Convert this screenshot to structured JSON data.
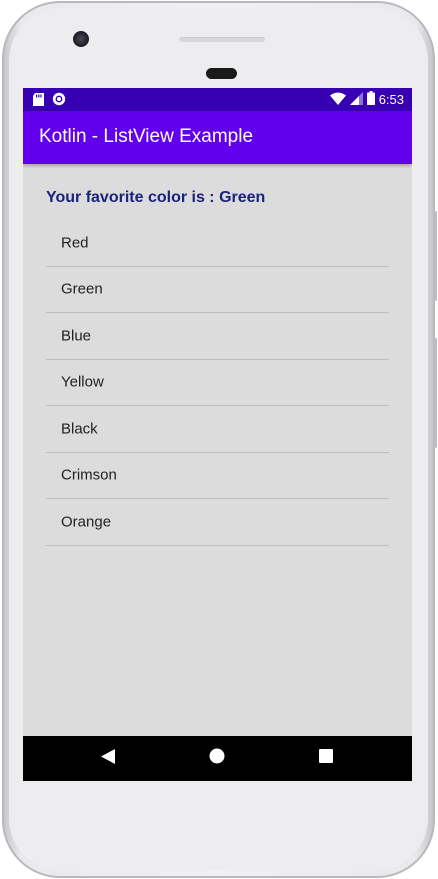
{
  "device": {
    "frame_color": "#f1f1f3",
    "camera_icon": "front-camera-icon",
    "speaker_icon": "earpiece-speaker-icon",
    "sensor_icon": "proximity-sensor-icon"
  },
  "status_bar": {
    "background": "#3700b3",
    "left_icons": [
      "sd-card-icon",
      "sync-circle-icon"
    ],
    "right_icons": [
      "wifi-icon",
      "cell-signal-icon",
      "battery-icon"
    ],
    "time": "6:53"
  },
  "app_bar": {
    "title": "Kotlin - ListView Example",
    "background": "#6200ee"
  },
  "content": {
    "selected_label": "Your favorite color is : Green",
    "label_color": "#1a237e"
  },
  "list": {
    "items": [
      {
        "label": "Red"
      },
      {
        "label": "Green"
      },
      {
        "label": "Blue"
      },
      {
        "label": "Yellow"
      },
      {
        "label": "Black"
      },
      {
        "label": "Crimson"
      },
      {
        "label": "Orange"
      }
    ]
  },
  "nav_bar": {
    "buttons": [
      {
        "icon": "back-triangle-icon"
      },
      {
        "icon": "home-circle-icon"
      },
      {
        "icon": "recents-square-icon"
      }
    ]
  }
}
